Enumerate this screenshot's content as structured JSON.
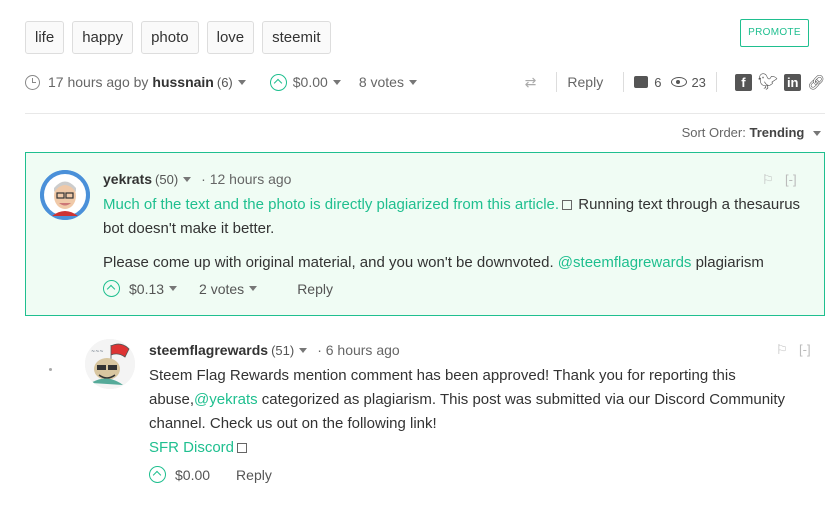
{
  "tags": [
    "life",
    "happy",
    "photo",
    "love",
    "steemit"
  ],
  "promote_label": "PROMOTE",
  "post": {
    "time": "17 hours ago by",
    "author": "hussnain",
    "rep": "(6)",
    "payout": "$0.00",
    "votes": "8 votes",
    "reply_label": "Reply",
    "responses": "6",
    "views": "23"
  },
  "sort": {
    "label": "Sort Order:",
    "value": "Trending"
  },
  "comments": [
    {
      "author": "yekrats",
      "rep": "(50)",
      "time": "· 12 hours ago",
      "link_text": "Much of the text and the photo is directly plagiarized from this article.",
      "text_after_link": " Running text through a thesaurus bot doesn't make it better.",
      "para2_before": "Please come up with original material, and you won't be downvoted. ",
      "mention": "@steemflagrewards",
      "para2_after": " plagiarism",
      "payout": "$0.13",
      "votes": "2 votes",
      "reply_label": "Reply",
      "collapse": "[-]"
    },
    {
      "author": "steemflagrewards",
      "rep": "(51)",
      "time": "· 6 hours ago",
      "text_before": "Steem Flag Rewards mention comment has been approved! Thank you for reporting this abuse,",
      "mention": "@yekrats",
      "text_after": " categorized as plagiarism. This post was submitted via our Discord Community channel. Check us out on the following link!",
      "link": "SFR Discord",
      "payout": "$0.00",
      "reply_label": "Reply",
      "collapse": "[-]"
    }
  ],
  "colors": {
    "accent": "#1fbf8f",
    "highlight_bg": "#f0fcf4"
  }
}
